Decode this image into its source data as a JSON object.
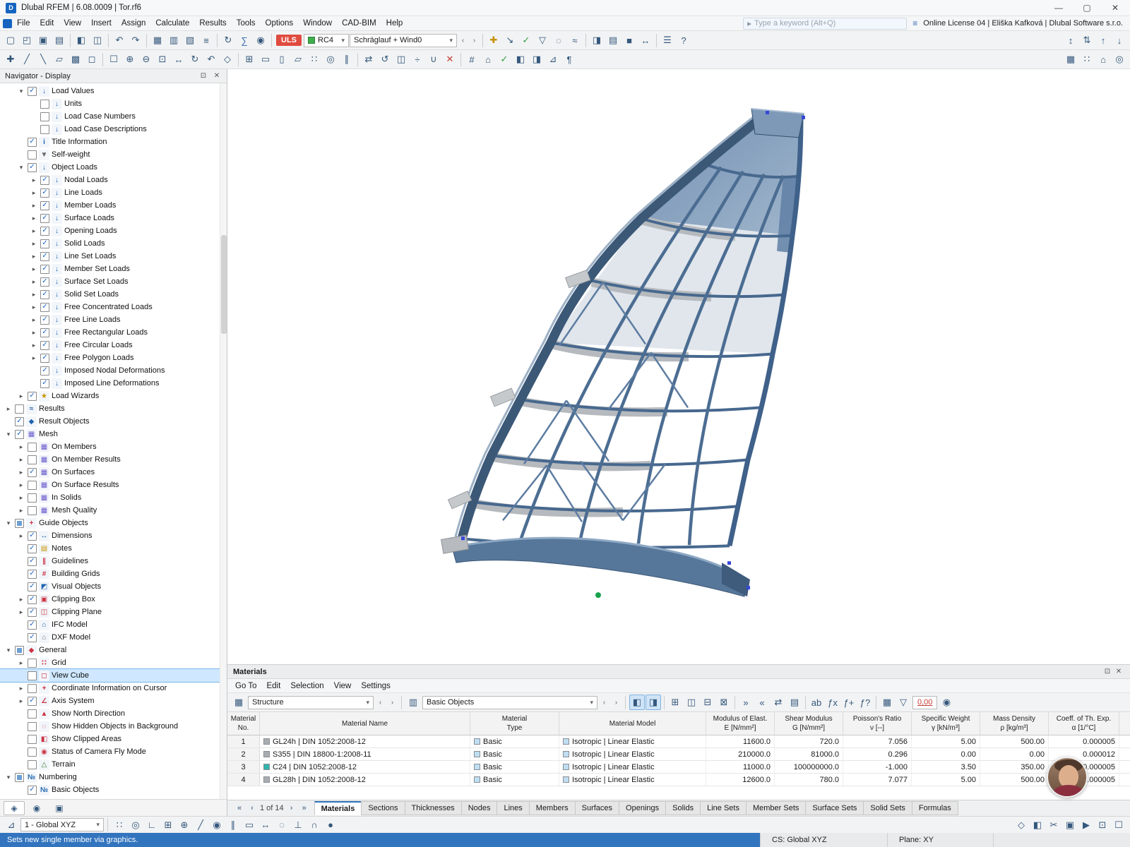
{
  "window": {
    "title": "Dlubal RFEM | 6.08.0009 | Tor.rf6",
    "logo": "D",
    "min": "—",
    "max": "▢",
    "close": "✕"
  },
  "ui": {
    "dd": "▾",
    "prev": "‹",
    "next": "›"
  },
  "menubar": {
    "items": [
      "File",
      "Edit",
      "View",
      "Insert",
      "Assign",
      "Calculate",
      "Results",
      "Tools",
      "Options",
      "Window",
      "CAD-BIM",
      "Help"
    ],
    "search_icon": "▸",
    "search_placeholder": "Type a keyword (Alt+Q)",
    "license_icon": "≡",
    "license": "Online License 04 | Eliška Kafková | Dlubal Software s.r.o."
  },
  "toolbars": {
    "uls": "ULS",
    "rc4": "RC4",
    "load_case": "Schräglauf + Wind0",
    "row1_left": [
      {
        "n": "new-model-icon",
        "g": "▢"
      },
      {
        "n": "open-model-icon",
        "g": "◰"
      },
      {
        "n": "save-model-icon",
        "g": "▣"
      },
      {
        "n": "print-icon",
        "g": "▤"
      },
      {
        "sep": true
      },
      {
        "n": "navigator-toggle-icon",
        "g": "◧"
      },
      {
        "n": "tables-toggle-icon",
        "g": "◫"
      },
      {
        "sep": true
      },
      {
        "n": "undo-icon",
        "g": "↶"
      },
      {
        "n": "redo-icon",
        "g": "↷"
      },
      {
        "sep": true
      },
      {
        "n": "table-view-icon",
        "g": "▦"
      },
      {
        "n": "spreadsheet-icon",
        "g": "▥"
      },
      {
        "n": "graphic-view-icon",
        "g": "▧"
      },
      {
        "n": "numbering-icon",
        "g": "≡"
      },
      {
        "sep": true
      },
      {
        "n": "regenerate-model-icon",
        "g": "↻"
      },
      {
        "n": "calculate-all-icon",
        "g": "∑",
        "col": "#3b6fb5"
      },
      {
        "n": "display-properties-icon",
        "g": "◉"
      }
    ],
    "row1_right": [
      {
        "n": "new-load-icon",
        "g": "✚",
        "col": "#c79100"
      },
      {
        "n": "assign-load-icon",
        "g": "↘"
      },
      {
        "n": "check-plausibility-icon",
        "g": "✓",
        "col": "#2f9e44"
      },
      {
        "n": "filter-objects-icon",
        "g": "▽"
      },
      {
        "n": "special-selection-icon",
        "g": "◌"
      },
      {
        "n": "show-results-icon",
        "g": "≈"
      },
      {
        "sep": true
      },
      {
        "n": "panel-toggle-icon",
        "g": "◨"
      },
      {
        "n": "printout-report-icon",
        "g": "▤"
      },
      {
        "n": "block-manager-icon",
        "g": "■"
      },
      {
        "n": "dimensions-icon",
        "g": "↔"
      },
      {
        "sep": true
      },
      {
        "n": "settings-icon",
        "g": "☰"
      },
      {
        "n": "help-icon",
        "g": "?"
      }
    ],
    "row1_far": [
      {
        "n": "sort-x-icon",
        "g": "↕"
      },
      {
        "n": "sort-y-icon",
        "g": "⇅"
      },
      {
        "n": "sort-z-icon",
        "g": "↑"
      },
      {
        "n": "sort-reset-icon",
        "g": "↓"
      }
    ],
    "row2_main": [
      {
        "n": "insert-node-icon",
        "g": "✚",
        "col": "#2f5577"
      },
      {
        "n": "insert-line-icon",
        "g": "╱"
      },
      {
        "n": "insert-member-icon",
        "g": "╲"
      },
      {
        "n": "insert-surface-icon",
        "g": "▱"
      },
      {
        "n": "insert-solid-icon",
        "g": "▩"
      },
      {
        "n": "insert-opening-icon",
        "g": "◻"
      },
      {
        "sep": true
      },
      {
        "n": "select-all-icon",
        "g": "☐"
      },
      {
        "n": "zoom-in-icon",
        "g": "⊕"
      },
      {
        "n": "zoom-out-icon",
        "g": "⊖"
      },
      {
        "n": "zoom-window-icon",
        "g": "⊡"
      },
      {
        "n": "pan-view-icon",
        "g": "↔"
      },
      {
        "n": "rotate-view-icon",
        "g": "↻"
      },
      {
        "n": "previous-view-icon",
        "g": "↶"
      },
      {
        "n": "isometric-view-icon",
        "g": "◇"
      },
      {
        "sep": true
      },
      {
        "n": "work-plane-icon",
        "g": "⊞"
      },
      {
        "n": "plane-xy-icon",
        "g": "▭"
      },
      {
        "n": "plane-yz-icon",
        "g": "▯"
      },
      {
        "n": "plane-xz-icon",
        "g": "▱"
      },
      {
        "n": "grid-snap-icon",
        "g": "∷"
      },
      {
        "n": "object-snap-icon",
        "g": "◎"
      },
      {
        "n": "guidelines-toggle-icon",
        "g": "∥"
      },
      {
        "sep": true
      },
      {
        "n": "move-copy-icon",
        "g": "⇄"
      },
      {
        "n": "rotate-copy-icon",
        "g": "↺"
      },
      {
        "n": "mirror-icon",
        "g": "◫"
      },
      {
        "n": "divide-member-icon",
        "g": "÷"
      },
      {
        "n": "connect-members-icon",
        "g": "∪"
      },
      {
        "n": "delete-objects-icon",
        "g": "✕",
        "col": "#c43c35"
      },
      {
        "sep": true
      },
      {
        "n": "line-grid-icon",
        "g": "#"
      },
      {
        "n": "background-layers-icon",
        "g": "⌂"
      },
      {
        "n": "snap-settings-icon",
        "g": "✓",
        "col": "#2f9e44"
      },
      {
        "n": "render-mode-icon",
        "g": "◧"
      },
      {
        "n": "shadow-mode-icon",
        "g": "◨"
      },
      {
        "n": "section-view-icon",
        "g": "⊿"
      },
      {
        "n": "margins-icon",
        "g": "¶"
      }
    ],
    "row2_right": [
      {
        "n": "display-grid-icon",
        "g": "▦"
      },
      {
        "n": "snap-toggle-icon",
        "g": "∷"
      },
      {
        "n": "layers-icon",
        "g": "⌂"
      },
      {
        "n": "osnap-settings-icon",
        "g": "◎"
      }
    ]
  },
  "navigator": {
    "title": "Navigator - Display",
    "float_icon": "⊡",
    "close_icon": "✕",
    "tabs": [
      {
        "n": "navigator-display-tab",
        "g": "◈"
      },
      {
        "n": "navigator-views-tab",
        "g": "◉"
      },
      {
        "n": "navigator-camera-tab",
        "g": "▣"
      }
    ],
    "tree": [
      {
        "l": "Load Values",
        "lv": 1,
        "c": 1,
        "a": "e",
        "i": "load"
      },
      {
        "l": "Units",
        "lv": 2,
        "c": 0,
        "a": "",
        "i": "load"
      },
      {
        "l": "Load Case Numbers",
        "lv": 2,
        "c": 0,
        "a": "",
        "i": "load"
      },
      {
        "l": "Load Case Descriptions",
        "lv": 2,
        "c": 0,
        "a": "",
        "i": "load"
      },
      {
        "l": "Title Information",
        "lv": 1,
        "c": 1,
        "a": "",
        "i": "title"
      },
      {
        "l": "Self-weight",
        "lv": 1,
        "c": 0,
        "a": "",
        "i": "weight"
      },
      {
        "l": "Object Loads",
        "lv": 1,
        "c": 1,
        "a": "e",
        "i": "load"
      },
      {
        "l": "Nodal Loads",
        "lv": 2,
        "c": 1,
        "a": "c",
        "i": "load"
      },
      {
        "l": "Line Loads",
        "lv": 2,
        "c": 1,
        "a": "c",
        "i": "load"
      },
      {
        "l": "Member Loads",
        "lv": 2,
        "c": 1,
        "a": "c",
        "i": "load"
      },
      {
        "l": "Surface Loads",
        "lv": 2,
        "c": 1,
        "a": "c",
        "i": "load"
      },
      {
        "l": "Opening Loads",
        "lv": 2,
        "c": 1,
        "a": "c",
        "i": "load"
      },
      {
        "l": "Solid Loads",
        "lv": 2,
        "c": 1,
        "a": "c",
        "i": "load"
      },
      {
        "l": "Line Set Loads",
        "lv": 2,
        "c": 1,
        "a": "c",
        "i": "load"
      },
      {
        "l": "Member Set Loads",
        "lv": 2,
        "c": 1,
        "a": "c",
        "i": "load"
      },
      {
        "l": "Surface Set Loads",
        "lv": 2,
        "c": 1,
        "a": "c",
        "i": "load"
      },
      {
        "l": "Solid Set Loads",
        "lv": 2,
        "c": 1,
        "a": "c",
        "i": "load"
      },
      {
        "l": "Free Concentrated Loads",
        "lv": 2,
        "c": 1,
        "a": "c",
        "i": "load"
      },
      {
        "l": "Free Line Loads",
        "lv": 2,
        "c": 1,
        "a": "c",
        "i": "load"
      },
      {
        "l": "Free Rectangular Loads",
        "lv": 2,
        "c": 1,
        "a": "c",
        "i": "load"
      },
      {
        "l": "Free Circular Loads",
        "lv": 2,
        "c": 1,
        "a": "c",
        "i": "load"
      },
      {
        "l": "Free Polygon Loads",
        "lv": 2,
        "c": 1,
        "a": "c",
        "i": "load"
      },
      {
        "l": "Imposed Nodal Deformations",
        "lv": 2,
        "c": 1,
        "a": "",
        "i": "load"
      },
      {
        "l": "Imposed Line Deformations",
        "lv": 2,
        "c": 1,
        "a": "",
        "i": "load"
      },
      {
        "l": "Load Wizards",
        "lv": 1,
        "c": 1,
        "a": "c",
        "i": "wizard"
      },
      {
        "l": "Results",
        "lv": 0,
        "c": 0,
        "a": "c",
        "i": "results"
      },
      {
        "l": "Result Objects",
        "lv": 0,
        "c": 1,
        "a": "",
        "i": "resultobj"
      },
      {
        "l": "Mesh",
        "lv": 0,
        "c": 1,
        "a": "e",
        "i": "mesh"
      },
      {
        "l": "On Members",
        "lv": 1,
        "c": 0,
        "a": "c",
        "i": "mesh"
      },
      {
        "l": "On Member Results",
        "lv": 1,
        "c": 0,
        "a": "c",
        "i": "mesh"
      },
      {
        "l": "On Surfaces",
        "lv": 1,
        "c": 1,
        "a": "c",
        "i": "mesh"
      },
      {
        "l": "On Surface Results",
        "lv": 1,
        "c": 0,
        "a": "c",
        "i": "mesh"
      },
      {
        "l": "In Solids",
        "lv": 1,
        "c": 0,
        "a": "c",
        "i": "mesh"
      },
      {
        "l": "Mesh Quality",
        "lv": 1,
        "c": 0,
        "a": "c",
        "i": "mesh"
      },
      {
        "l": "Guide Objects",
        "lv": 0,
        "c": 2,
        "a": "e",
        "i": "guide"
      },
      {
        "l": "Dimensions",
        "lv": 1,
        "c": 1,
        "a": "c",
        "i": "dimensions"
      },
      {
        "l": "Notes",
        "lv": 1,
        "c": 1,
        "a": "",
        "i": "notes"
      },
      {
        "l": "Guidelines",
        "lv": 1,
        "c": 1,
        "a": "",
        "i": "guidelines"
      },
      {
        "l": "Building Grids",
        "lv": 1,
        "c": 1,
        "a": "",
        "i": "grids"
      },
      {
        "l": "Visual Objects",
        "lv": 1,
        "c": 1,
        "a": "",
        "i": "visual"
      },
      {
        "l": "Clipping Box",
        "lv": 1,
        "c": 1,
        "a": "c",
        "i": "clipbox"
      },
      {
        "l": "Clipping Plane",
        "lv": 1,
        "c": 1,
        "a": "c",
        "i": "clipplane"
      },
      {
        "l": "IFC Model",
        "lv": 1,
        "c": 1,
        "a": "",
        "i": "ifc"
      },
      {
        "l": "DXF Model",
        "lv": 1,
        "c": 1,
        "a": "",
        "i": "dxf"
      },
      {
        "l": "General",
        "lv": 0,
        "c": 2,
        "a": "e",
        "i": "general"
      },
      {
        "l": "Grid",
        "lv": 1,
        "c": 0,
        "a": "c",
        "i": "grid"
      },
      {
        "l": "View Cube",
        "lv": 1,
        "c": 0,
        "a": "",
        "i": "viewcube",
        "sel": true
      },
      {
        "l": "Coordinate Information on Cursor",
        "lv": 1,
        "c": 0,
        "a": "c",
        "i": "cursor"
      },
      {
        "l": "Axis System",
        "lv": 1,
        "c": 1,
        "a": "c",
        "i": "axis"
      },
      {
        "l": "Show North Direction",
        "lv": 1,
        "c": 0,
        "a": "",
        "i": "north"
      },
      {
        "l": "Show Hidden Objects in Background",
        "lv": 1,
        "c": 0,
        "a": "",
        "i": "hidden"
      },
      {
        "l": "Show Clipped Areas",
        "lv": 1,
        "c": 0,
        "a": "",
        "i": "clipped"
      },
      {
        "l": "Status of Camera Fly Mode",
        "lv": 1,
        "c": 0,
        "a": "",
        "i": "camera"
      },
      {
        "l": "Terrain",
        "lv": 1,
        "c": 0,
        "a": "",
        "i": "terrain"
      },
      {
        "l": "Numbering",
        "lv": 0,
        "c": 2,
        "a": "e",
        "i": "numbering"
      },
      {
        "l": "Basic Objects",
        "lv": 1,
        "c": 1,
        "a": "",
        "i": "numbering"
      }
    ]
  },
  "materials": {
    "title": "Materials",
    "float_icon": "⊡",
    "close_icon": "✕",
    "menu": [
      "Go To",
      "Edit",
      "Selection",
      "View",
      "Settings"
    ],
    "toolbar": {
      "group_icon": "▦",
      "combo1": "Structure",
      "type_icon": "▥",
      "combo2": "Basic Objects",
      "value": "0,00",
      "search_icon": "◉",
      "icons": [
        {
          "n": "sync-selection-icon",
          "g": "◧",
          "hl": true
        },
        {
          "n": "highlight-in-graphic-icon",
          "g": "◨",
          "hl": true
        },
        {
          "sep": true
        },
        {
          "n": "add-row-icon",
          "g": "⊞"
        },
        {
          "n": "copy-row-icon",
          "g": "◫"
        },
        {
          "n": "insert-row-icon",
          "g": "⊟"
        },
        {
          "n": "delete-row-icon",
          "g": "⊠"
        },
        {
          "sep": true
        },
        {
          "n": "import-table-icon",
          "g": "»"
        },
        {
          "n": "export-table-icon",
          "g": "«"
        },
        {
          "n": "exchange-table-icon",
          "g": "⇄"
        },
        {
          "n": "print-table-icon",
          "g": "▤"
        },
        {
          "sep": true
        },
        {
          "n": "font-style-icon",
          "g": "ab"
        },
        {
          "n": "formula-icon",
          "g": "ƒx"
        },
        {
          "n": "formula-edit-icon",
          "g": "ƒ+"
        },
        {
          "n": "formula-check-icon",
          "g": "ƒ?"
        },
        {
          "sep": true
        },
        {
          "n": "library-icon",
          "g": "▦"
        },
        {
          "n": "view-options-icon",
          "g": "▽"
        }
      ]
    },
    "table": {
      "type_color": "#bfdef2",
      "model_color": "#bfdef2",
      "headers": [
        {
          "t": "Material",
          "s": "No."
        },
        {
          "t": "Material Name",
          "s": ""
        },
        {
          "t": "Material",
          "s": "Type"
        },
        {
          "t": "Material Model",
          "s": ""
        },
        {
          "t": "Modulus of Elast.",
          "s": "E [N/mm²]"
        },
        {
          "t": "Shear Modulus",
          "s": "G [N/mm²]"
        },
        {
          "t": "Poisson's Ratio",
          "s": "ν [--]"
        },
        {
          "t": "Specific Weight",
          "s": "γ [kN/m³]"
        },
        {
          "t": "Mass Density",
          "s": "ρ [kg/m³]"
        },
        {
          "t": "Coeff. of Th. Exp.",
          "s": "α [1/°C]"
        }
      ],
      "rows": [
        {
          "no": "1",
          "color": "#a9adb2",
          "name": "GL24h | DIN 1052:2008-12",
          "type": "Basic",
          "model": "Isotropic | Linear Elastic",
          "e": "11600.0",
          "g": "720.0",
          "nu": "7.056",
          "gamma": "5.00",
          "rho": "500.00",
          "alpha": "0.000005"
        },
        {
          "no": "2",
          "color": "#a9adb2",
          "name": "S355 | DIN 18800-1:2008-11",
          "type": "Basic",
          "model": "Isotropic | Linear Elastic",
          "e": "210000.0",
          "g": "81000.0",
          "nu": "0.296",
          "gamma": "0.00",
          "rho": "0.00",
          "alpha": "0.000012"
        },
        {
          "no": "3",
          "color": "#2fb5ad",
          "name": "C24 | DIN 1052:2008-12",
          "type": "Basic",
          "model": "Isotropic | Linear Elastic",
          "e": "11000.0",
          "g": "100000000.0",
          "nu": "-1.000",
          "gamma": "3.50",
          "rho": "350.00",
          "alpha": "0.000005"
        },
        {
          "no": "4",
          "color": "#a9adb2",
          "name": "GL28h | DIN 1052:2008-12",
          "type": "Basic",
          "model": "Isotropic | Linear Elastic",
          "e": "12600.0",
          "g": "780.0",
          "nu": "7.077",
          "gamma": "5.00",
          "rho": "500.00",
          "alpha": "0.000005"
        }
      ]
    },
    "pager": {
      "first": "«",
      "prev": "‹",
      "label": "1 of 14",
      "next": "›",
      "last": "»"
    },
    "tabs": [
      "Materials",
      "Sections",
      "Thicknesses",
      "Nodes",
      "Lines",
      "Members",
      "Surfaces",
      "Openings",
      "Solids",
      "Line Sets",
      "Member Sets",
      "Surface Sets",
      "Solid Sets",
      "Formulas"
    ]
  },
  "status_toolbar": {
    "combo_icon": "⊿",
    "combo": "1 - Global XYZ",
    "icons_a": [
      {
        "n": "grid-toggle-icon",
        "g": "∷"
      },
      {
        "n": "snap-icon",
        "g": "◎"
      },
      {
        "n": "ortho-mode-icon",
        "g": "∟"
      },
      {
        "n": "cartesian-grid-icon",
        "g": "⊞"
      },
      {
        "n": "polar-grid-icon",
        "g": "⊕"
      },
      {
        "n": "construction-lines-icon",
        "g": "╱"
      },
      {
        "n": "object-snap-icon",
        "g": "◉"
      },
      {
        "n": "guideline-snap-icon",
        "g": "∥"
      },
      {
        "n": "work-plane-icon",
        "g": "▭"
      },
      {
        "n": "dimension-snap-icon",
        "g": "↔"
      },
      {
        "n": "center-snap-icon",
        "g": "◌"
      },
      {
        "n": "perpendicular-snap-icon",
        "g": "⊥"
      },
      {
        "n": "intersection-snap-icon",
        "g": "∩"
      },
      {
        "n": "node-snap-icon",
        "g": "●"
      }
    ],
    "icons_b": [
      {
        "n": "view-3d-icon",
        "g": "◇"
      },
      {
        "n": "render-toggle-icon",
        "g": "◧"
      },
      {
        "n": "clipping-icon",
        "g": "✂"
      },
      {
        "n": "clipping-box-icon",
        "g": "▣"
      },
      {
        "n": "camera-fly-icon",
        "g": "▶"
      },
      {
        "n": "fullscreen-icon",
        "g": "⊡"
      },
      {
        "n": "selection-mode-icon",
        "g": "☐"
      }
    ]
  },
  "statusbar": {
    "hint": "Sets new single member via graphics.",
    "cs": "CS: Global XYZ",
    "plane": "Plane: XY"
  }
}
